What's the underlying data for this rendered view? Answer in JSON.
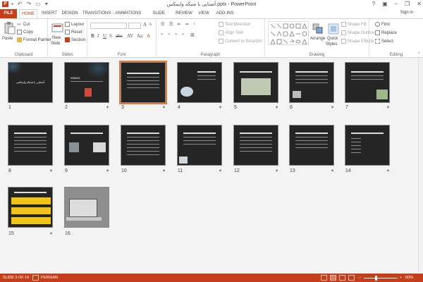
{
  "window": {
    "title": "آشنایی با شبکه وایمکس.pptx - PowerPoint",
    "sign_in": "Sign in",
    "app_icon_letter": "P"
  },
  "tabs": [
    "FILE",
    "HOME",
    "INSERT",
    "DESIGN",
    "TRANSITIONS",
    "ANIMATIONS",
    "SLIDE SHOW",
    "REVIEW",
    "VIEW",
    "ADD-INS"
  ],
  "active_tab": "HOME",
  "ribbon": {
    "clipboard": {
      "label": "Clipboard",
      "paste": "Paste",
      "cut": "Cut",
      "copy": "Copy",
      "format_painter": "Format Painter"
    },
    "slides": {
      "label": "Slides",
      "new_slide": "New",
      "new_slide_2": "Slide",
      "layout": "Layout",
      "reset": "Reset",
      "section": "Section"
    },
    "font": {
      "label": "Font",
      "font_name": "",
      "font_size": ""
    },
    "paragraph": {
      "label": "Paragraph",
      "text_direction": "Text Direction",
      "align_text": "Align Text",
      "convert_smartart": "Convert to SmartArt"
    },
    "drawing": {
      "label": "Drawing",
      "arrange": "Arrange",
      "quick_styles": "Quick",
      "quick_styles_2": "Styles",
      "shape_fill": "Shape Fill",
      "shape_outline": "Shape Outline",
      "shape_effects": "Shape Effects"
    },
    "editing": {
      "label": "Editing",
      "find": "Find",
      "replace": "Replace",
      "select": "Select"
    }
  },
  "slides": [
    {
      "number": "1",
      "star": ""
    },
    {
      "number": "2",
      "star": "✶"
    },
    {
      "number": "3",
      "star": "✶"
    },
    {
      "number": "4",
      "star": "✶"
    },
    {
      "number": "5",
      "star": "✶"
    },
    {
      "number": "6",
      "star": "✶"
    },
    {
      "number": "7",
      "star": "✶"
    },
    {
      "number": "8",
      "star": "✶"
    },
    {
      "number": "9",
      "star": "✶"
    },
    {
      "number": "10",
      "star": "✶"
    },
    {
      "number": "11",
      "star": "✶"
    },
    {
      "number": "12",
      "star": "✶"
    },
    {
      "number": "13",
      "star": "✶"
    },
    {
      "number": "14",
      "star": "✶"
    },
    {
      "number": "15",
      "star": "✶"
    },
    {
      "number": "16",
      "star": ""
    }
  ],
  "selected_slide": "3",
  "slide_titles": {
    "slide1": "آشنایی با شبکه وایمکس",
    "slide2": "WIMAX"
  },
  "statusbar": {
    "slide_info": "SLIDE 3 OF 16",
    "language": "PERSIAN",
    "zoom": "60%",
    "zoom_out": "−",
    "zoom_in": "+"
  },
  "colors": {
    "accent": "#c43e1c",
    "selection": "#e3793e",
    "slide_bg": "#252525"
  }
}
